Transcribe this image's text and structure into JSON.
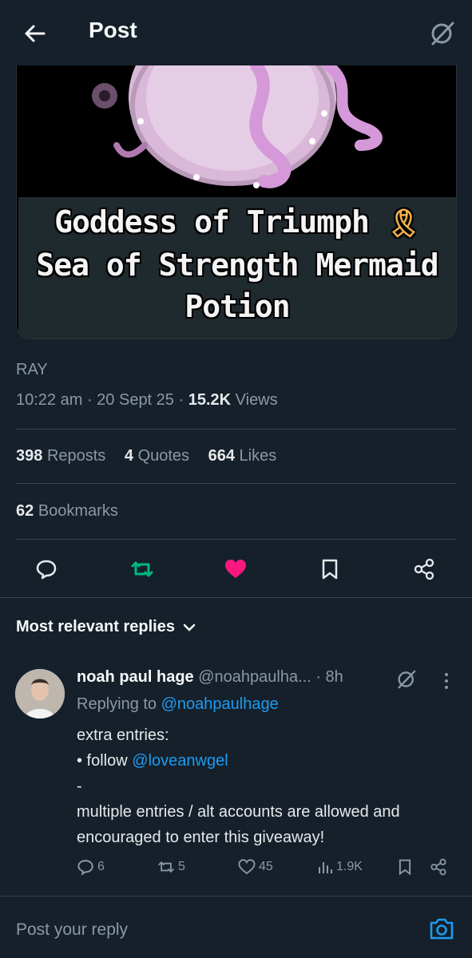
{
  "header": {
    "title": "Post",
    "back_icon": "arrow-left-icon",
    "grok_icon": "grok-icon"
  },
  "media": {
    "caption_line1": "Goddess of Triumph",
    "caption_line2": "Sea of Strength Mermaid",
    "caption_line3": "Potion",
    "ribbon_emoji": "🎗"
  },
  "post": {
    "author": "RAY",
    "time": "10:22 am",
    "date": "20 Sept 25",
    "views_count": "15.2K",
    "views_label": "Views"
  },
  "stats": {
    "reposts_count": "398",
    "reposts_label": "Reposts",
    "quotes_count": "4",
    "quotes_label": "Quotes",
    "likes_count": "664",
    "likes_label": "Likes",
    "bookmarks_count": "62",
    "bookmarks_label": "Bookmarks"
  },
  "actions": {
    "reply_icon": "comment-icon",
    "repost_icon": "repost-icon",
    "like_icon": "heart-filled-icon",
    "bookmark_icon": "bookmark-icon",
    "share_icon": "share-icon"
  },
  "colors": {
    "repost_active": "#00ba7c",
    "like_active": "#f91880",
    "link": "#1d9bf0",
    "background": "#15202b"
  },
  "replies_sort": {
    "label": "Most relevant replies"
  },
  "reply": {
    "name": "noah paul hage",
    "handle": "@noahpaulha...",
    "time": "· 8h",
    "replying_prefix": "Replying to",
    "replying_to": "@noahpaulhage",
    "line1": "extra entries:",
    "line2_prefix": "• follow",
    "line2_link": "@loveanwgel",
    "line3": "-",
    "line4": "multiple entries / alt accounts are allowed and encouraged to enter this giveaway!",
    "replies_count": "6",
    "reposts_count": "5",
    "likes_count": "45",
    "views_count": "1.9K"
  },
  "composer": {
    "placeholder": "Post your reply"
  }
}
